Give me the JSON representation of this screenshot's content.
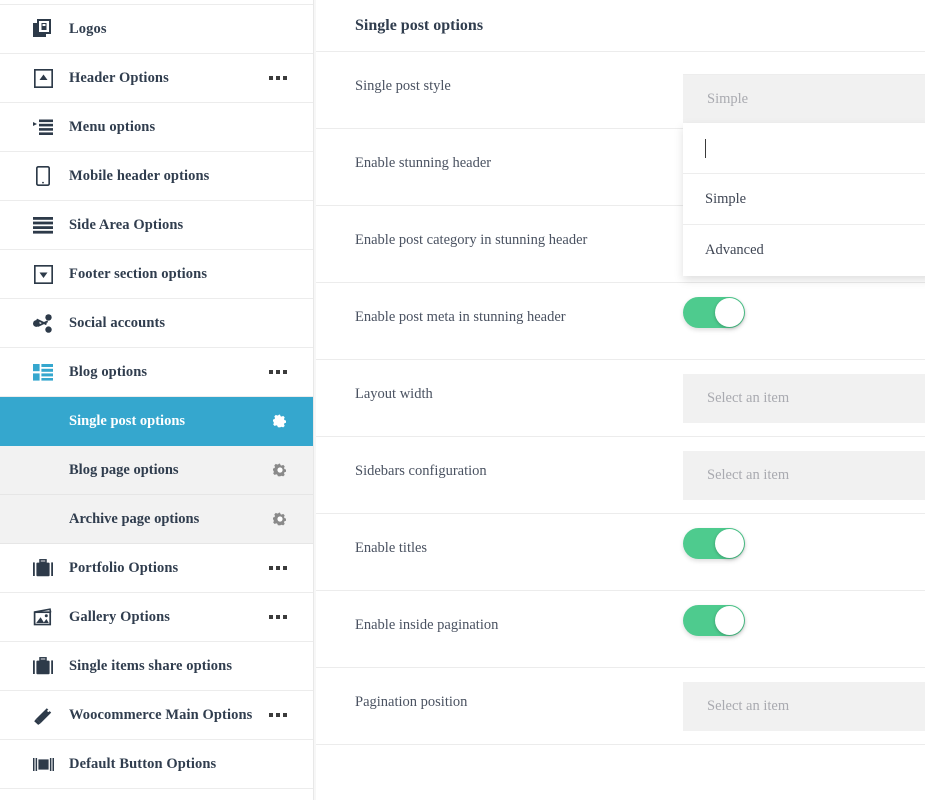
{
  "sidebar": {
    "items": [
      {
        "label": "Logos",
        "icon": "logos-icon",
        "dots": false
      },
      {
        "label": "Header Options",
        "icon": "header-options-icon",
        "dots": true
      },
      {
        "label": "Menu options",
        "icon": "menu-options-icon",
        "dots": false
      },
      {
        "label": "Mobile header options",
        "icon": "mobile-header-icon",
        "dots": false
      },
      {
        "label": "Side Area Options",
        "icon": "side-area-icon",
        "dots": false
      },
      {
        "label": "Footer section options",
        "icon": "footer-section-icon",
        "dots": false
      },
      {
        "label": "Social accounts",
        "icon": "social-accounts-icon",
        "dots": false
      },
      {
        "label": "Blog options",
        "icon": "blog-options-icon",
        "dots": true,
        "active_parent": true
      },
      {
        "label": "Portfolio Options",
        "icon": "portfolio-icon",
        "dots": true
      },
      {
        "label": "Gallery Options",
        "icon": "gallery-icon",
        "dots": true
      },
      {
        "label": "Single items share options",
        "icon": "single-items-share-icon",
        "dots": false
      },
      {
        "label": "Woocommerce Main Options",
        "icon": "woocommerce-icon",
        "dots": true
      },
      {
        "label": "Default Button Options",
        "icon": "default-button-icon",
        "dots": false
      }
    ],
    "sub_items": [
      {
        "label": "Single post options",
        "active": true,
        "icon": "gear-icon"
      },
      {
        "label": "Blog page options",
        "active": false,
        "icon": "gear-icon"
      },
      {
        "label": "Archive page options",
        "active": false,
        "icon": "gear-icon"
      }
    ],
    "active_color": "#35a7ce"
  },
  "main": {
    "title": "Single post options",
    "rows": [
      {
        "label": "Single post style",
        "control": "dropdown-open"
      },
      {
        "label": "Enable stunning header",
        "control": "toggle-hidden"
      },
      {
        "label": "Enable post category in stunning header",
        "control": "toggle-hidden"
      },
      {
        "label": "Enable post meta in stunning header",
        "control": "toggle",
        "value": "on"
      },
      {
        "label": "Layout width",
        "control": "select",
        "placeholder": "Select an item"
      },
      {
        "label": "Sidebars configuration",
        "control": "select",
        "placeholder": "Select an item"
      },
      {
        "label": "Enable titles",
        "control": "toggle",
        "value": "on"
      },
      {
        "label": "Enable inside pagination",
        "control": "toggle",
        "value": "on"
      },
      {
        "label": "Pagination position",
        "control": "select",
        "placeholder": "Select an item"
      }
    ]
  },
  "dropdown": {
    "selected_label": "Simple",
    "search_value": "",
    "options": [
      {
        "label": "Simple"
      },
      {
        "label": "Advanced"
      }
    ]
  },
  "colors": {
    "accent_blue": "#35a7ce",
    "toggle_green": "#4ecb8e",
    "field_gray": "#f1f1f1",
    "text_dark": "#303d4e"
  }
}
